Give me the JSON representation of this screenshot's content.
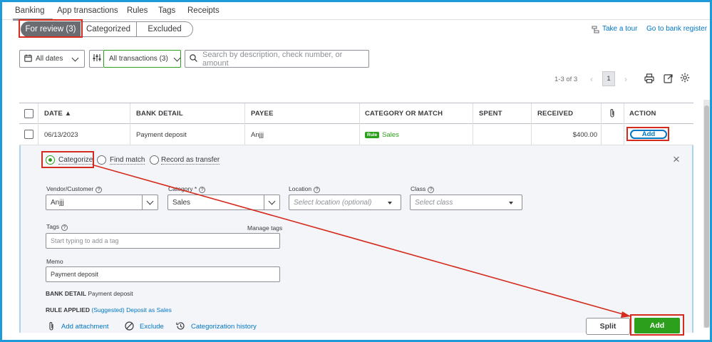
{
  "top_tabs": [
    "Banking",
    "App transactions",
    "Rules",
    "Tags",
    "Receipts"
  ],
  "review_tabs": {
    "for_review": "For review (3)",
    "categorized": "Categorized",
    "excluded": "Excluded"
  },
  "header_links": {
    "tour": "Take a tour",
    "bank_register": "Go to bank register"
  },
  "filters": {
    "dates": "All dates",
    "transactions": "All transactions (3)",
    "search_placeholder": "Search by description, check number, or amount"
  },
  "pagination": {
    "range": "1-3 of 3",
    "page": "1"
  },
  "table": {
    "headers": {
      "date": "DATE ▲",
      "bank_detail": "BANK DETAIL",
      "payee": "PAYEE",
      "category": "CATEGORY OR MATCH",
      "spent": "SPENT",
      "received": "RECEIVED",
      "action": "ACTION"
    },
    "row": {
      "date": "06/13/2023",
      "bank_detail": "Payment deposit",
      "payee": "Anjjj",
      "rule_badge": "Rule",
      "category": "Sales",
      "spent": "",
      "received": "$400.00",
      "action": "Add"
    }
  },
  "panel": {
    "radios": {
      "categorize": "Categorize",
      "find_match": "Find match",
      "record_transfer": "Record as transfer"
    },
    "close": "×",
    "labels": {
      "vendor": "Vendor/Customer",
      "category": "Category *",
      "location": "Location",
      "class": "Class",
      "tags": "Tags",
      "manage_tags": "Manage tags",
      "memo": "Memo"
    },
    "values": {
      "vendor": "Anjjj",
      "category": "Sales",
      "location_placeholder": "Select location (optional)",
      "class_placeholder": "Select class",
      "tags_placeholder": "Start typing to add a tag",
      "memo": "Payment deposit"
    },
    "bank_detail_label": "BANK DETAIL",
    "bank_detail_value": "Payment deposit",
    "rule_applied_label": "RULE APPLIED",
    "rule_applied_link": "(Suggested) Deposit as Sales",
    "footer": {
      "attachment": "Add attachment",
      "exclude": "Exclude",
      "history": "Categorization history"
    },
    "buttons": {
      "split": "Split",
      "add": "Add"
    }
  },
  "colors": {
    "accent_green": "#2ca01c",
    "link_blue": "#0077c5",
    "annotation_red": "#d52b1e",
    "frame_blue": "#1d9bd8"
  },
  "icons": [
    "calendar-icon",
    "filter-sliders-icon",
    "search-icon",
    "print-icon",
    "export-icon",
    "gear-icon",
    "attachment-icon",
    "exclude-icon",
    "history-icon",
    "tour-icon",
    "close-icon"
  ]
}
